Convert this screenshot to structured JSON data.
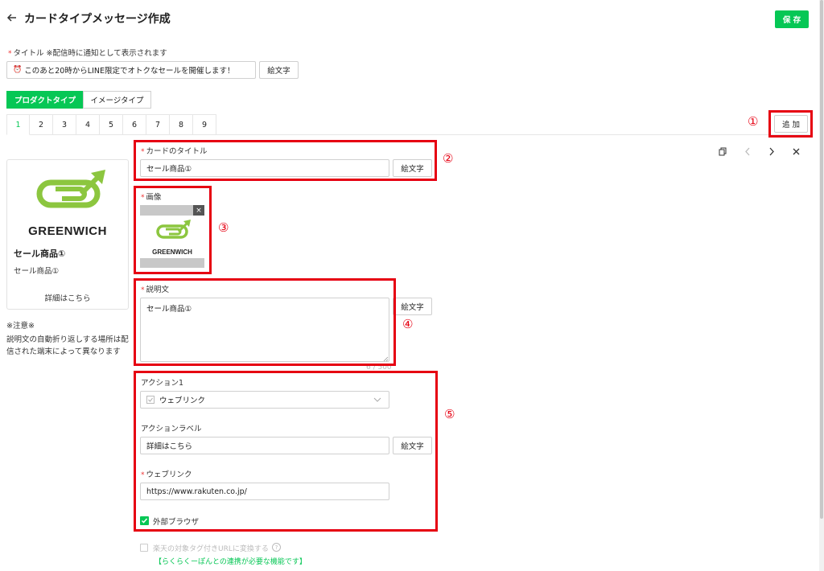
{
  "header": {
    "title": "カードタイプメッセージ作成",
    "save_label": "保 存"
  },
  "title_field": {
    "label": "タイトル ※配信時に通知として表示されます",
    "value": "このあと20時からLINE限定でオトクなセールを開催します！",
    "emoji_label": "絵文字"
  },
  "type_tabs": [
    "プロダクトタイプ",
    "イメージタイプ"
  ],
  "card_tabs": [
    "1",
    "2",
    "3",
    "4",
    "5",
    "6",
    "7",
    "8",
    "9"
  ],
  "add_label": "追 加",
  "preview": {
    "brand": "GREENWICH",
    "title": "セール商品①",
    "desc": "セール商品①",
    "link": "詳細はこちら"
  },
  "note": {
    "title": "※注意※",
    "text": "説明文の自動折り返しする場所は配信された端末によって異なります"
  },
  "card_title": {
    "label": "カードのタイトル",
    "value": "セール商品①",
    "emoji_label": "絵文字"
  },
  "image": {
    "label": "画像",
    "brand": "GREENWICH"
  },
  "description": {
    "label": "説明文",
    "value": "セール商品①",
    "emoji_label": "絵文字",
    "counter": "6 / 500"
  },
  "action": {
    "label": "アクション1",
    "type_value": "ウェブリンク",
    "action_label_label": "アクションラベル",
    "action_label_value": "詳細はこちら",
    "emoji_label": "絵文字",
    "weblink_label": "ウェブリンク",
    "weblink_value": "https://www.rakuten.co.jp/",
    "browser_label": "外部ブラウザ"
  },
  "footer": {
    "convert_text": "楽天の対象タグ付きURLに変換する",
    "link_text": "【らくらくーぽんとの連携が必要な機能です】"
  },
  "annotations": [
    "①",
    "②",
    "③",
    "④",
    "⑤"
  ],
  "colors": {
    "accent": "#06c755",
    "highlight": "#e60012",
    "logo_green": "#8cc63f"
  }
}
